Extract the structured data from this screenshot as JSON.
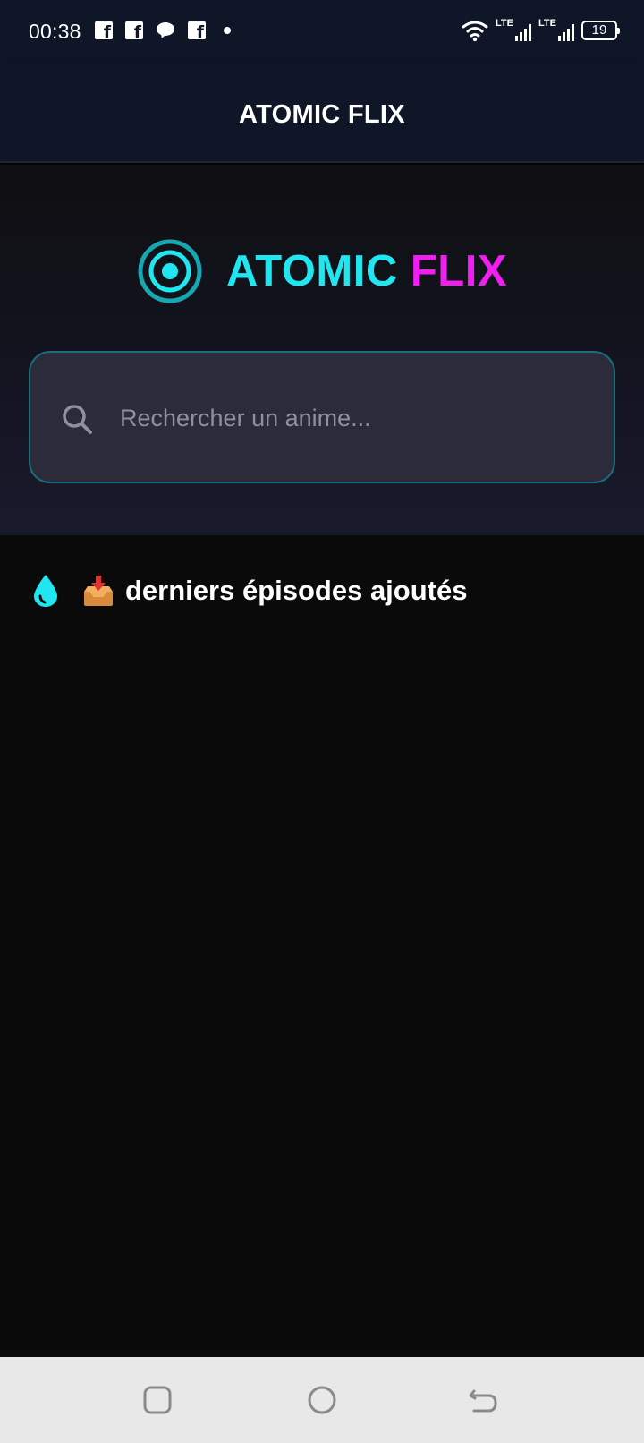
{
  "status_bar": {
    "time": "00:38",
    "notifications": [
      "facebook-icon",
      "facebook-icon",
      "messenger-icon",
      "facebook-icon",
      "dot-icon"
    ],
    "network_label_1": "LTE",
    "network_label_2": "LTE",
    "battery_level": "19"
  },
  "app_bar": {
    "title": "ATOMIC FLIX"
  },
  "hero": {
    "logo_atomic": "ATOMIC",
    "logo_flix": "FLIX",
    "search_placeholder": "Rechercher un anime..."
  },
  "section": {
    "title": "derniers épisodes ajoutés",
    "icons": [
      "drop-icon",
      "inbox-tray-icon"
    ]
  },
  "colors": {
    "accent_cyan": "#1fe6f0",
    "accent_magenta": "#f01ff0",
    "header_bg": "#0e1628",
    "page_bg": "#0a0a0b",
    "search_bg": "#2c2b3b",
    "search_border": "#1b6d7c"
  },
  "nav_bar": {
    "buttons": [
      "recents-button",
      "home-button",
      "back-button"
    ]
  }
}
